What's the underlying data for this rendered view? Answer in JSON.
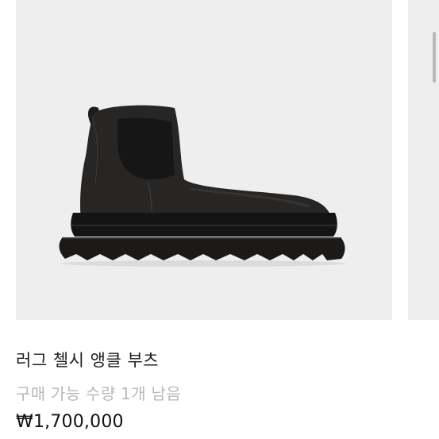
{
  "product": {
    "title": "러그 첼시 앵클 부츠",
    "stock_text": "구매 가능 수량 1개 남음",
    "price": "₩1,700,000"
  },
  "image": {
    "subject": "black-leather-chelsea-boot",
    "background_color": "#efeeef"
  }
}
